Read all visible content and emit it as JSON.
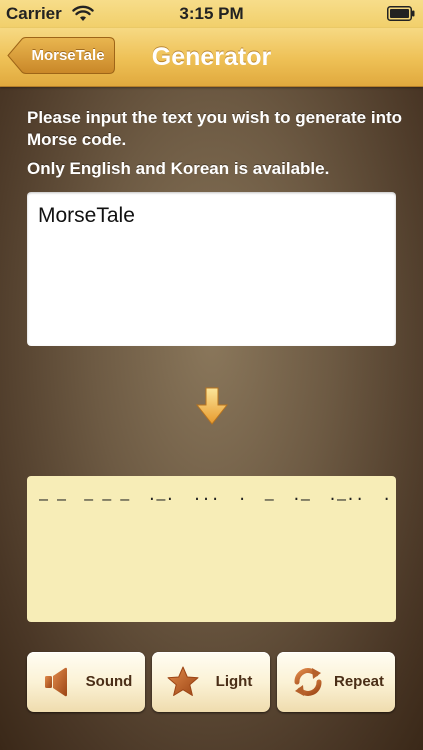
{
  "status_bar": {
    "carrier": "Carrier",
    "time": "3:15 PM",
    "wifi_icon": "wifi-icon",
    "battery_icon": "battery-icon"
  },
  "nav": {
    "back_label": "MorseTale",
    "title": "Generator"
  },
  "instructions": {
    "line1": "Please input the text you wish to generate into Morse code.",
    "line2": "Only English and Korean is available."
  },
  "input": {
    "value": "MorseTale"
  },
  "arrow_icon": "arrow-down-icon",
  "output": {
    "morse": "— —  — — —  ·—·  ···  ·  —  ·—  ·—··  ·"
  },
  "buttons": [
    {
      "label": "Sound",
      "icon": "speaker-icon"
    },
    {
      "label": "Light",
      "icon": "star-icon"
    },
    {
      "label": "Repeat",
      "icon": "repeat-icon"
    }
  ],
  "colors": {
    "nav_gold": "#eec055",
    "background_brown": "#6d5a43",
    "output_bg": "#f7edb7",
    "button_text": "#4a2e17",
    "icon_brown": "#a9531d"
  }
}
